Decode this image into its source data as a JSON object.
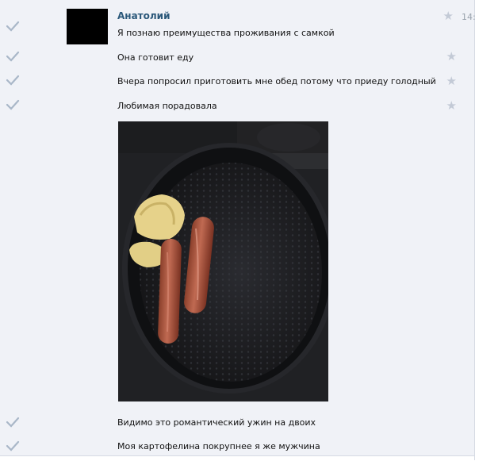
{
  "dialog": {
    "author": "Анатолий",
    "time": "14:",
    "messages": [
      "Я познаю преимущества проживания с самкой",
      "Она готовит еду",
      "Вчера попросил приготовить мне обед потому что приеду голодный",
      "Любимая порадовала",
      "Видимо это романтический ужин на двоих",
      "Моя картофелина покрупнее я же мужчина"
    ]
  },
  "icons": {
    "read_status": "check-icon",
    "favorite": "star-icon"
  },
  "colors": {
    "background": "#f0f2f7",
    "author_name": "#2b587a",
    "check": "#a9b7c8",
    "star": "#c3cad6"
  }
}
